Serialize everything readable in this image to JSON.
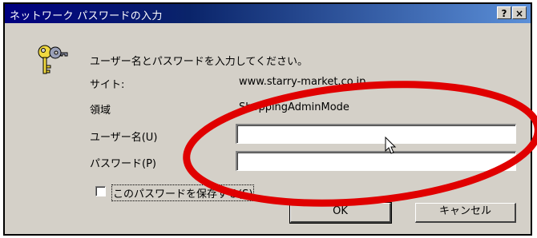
{
  "window": {
    "title": "ネットワーク パスワードの入力",
    "help_button": "?",
    "close_button": "×"
  },
  "dialog": {
    "prompt": "ユーザー名とパスワードを入力してください。",
    "site_label": "サイト:",
    "site_value": "www.starry-market.co.jp",
    "realm_label": "領域",
    "realm_value": "ShoppingAdminMode",
    "username_label": "ユーザー名(U)",
    "username_value": "",
    "password_label": "パスワード(P)",
    "password_value": "",
    "save_password_label": "このパスワードを保存する(S)",
    "save_password_checked": false,
    "ok_label": "OK",
    "cancel_label": "キャンセル"
  },
  "icons": {
    "dialog_icon": "keys-icon",
    "cursor": "mouse-pointer-icon"
  },
  "colors": {
    "title_bar": "#0a246a",
    "annotation_ellipse": "#e00000"
  }
}
